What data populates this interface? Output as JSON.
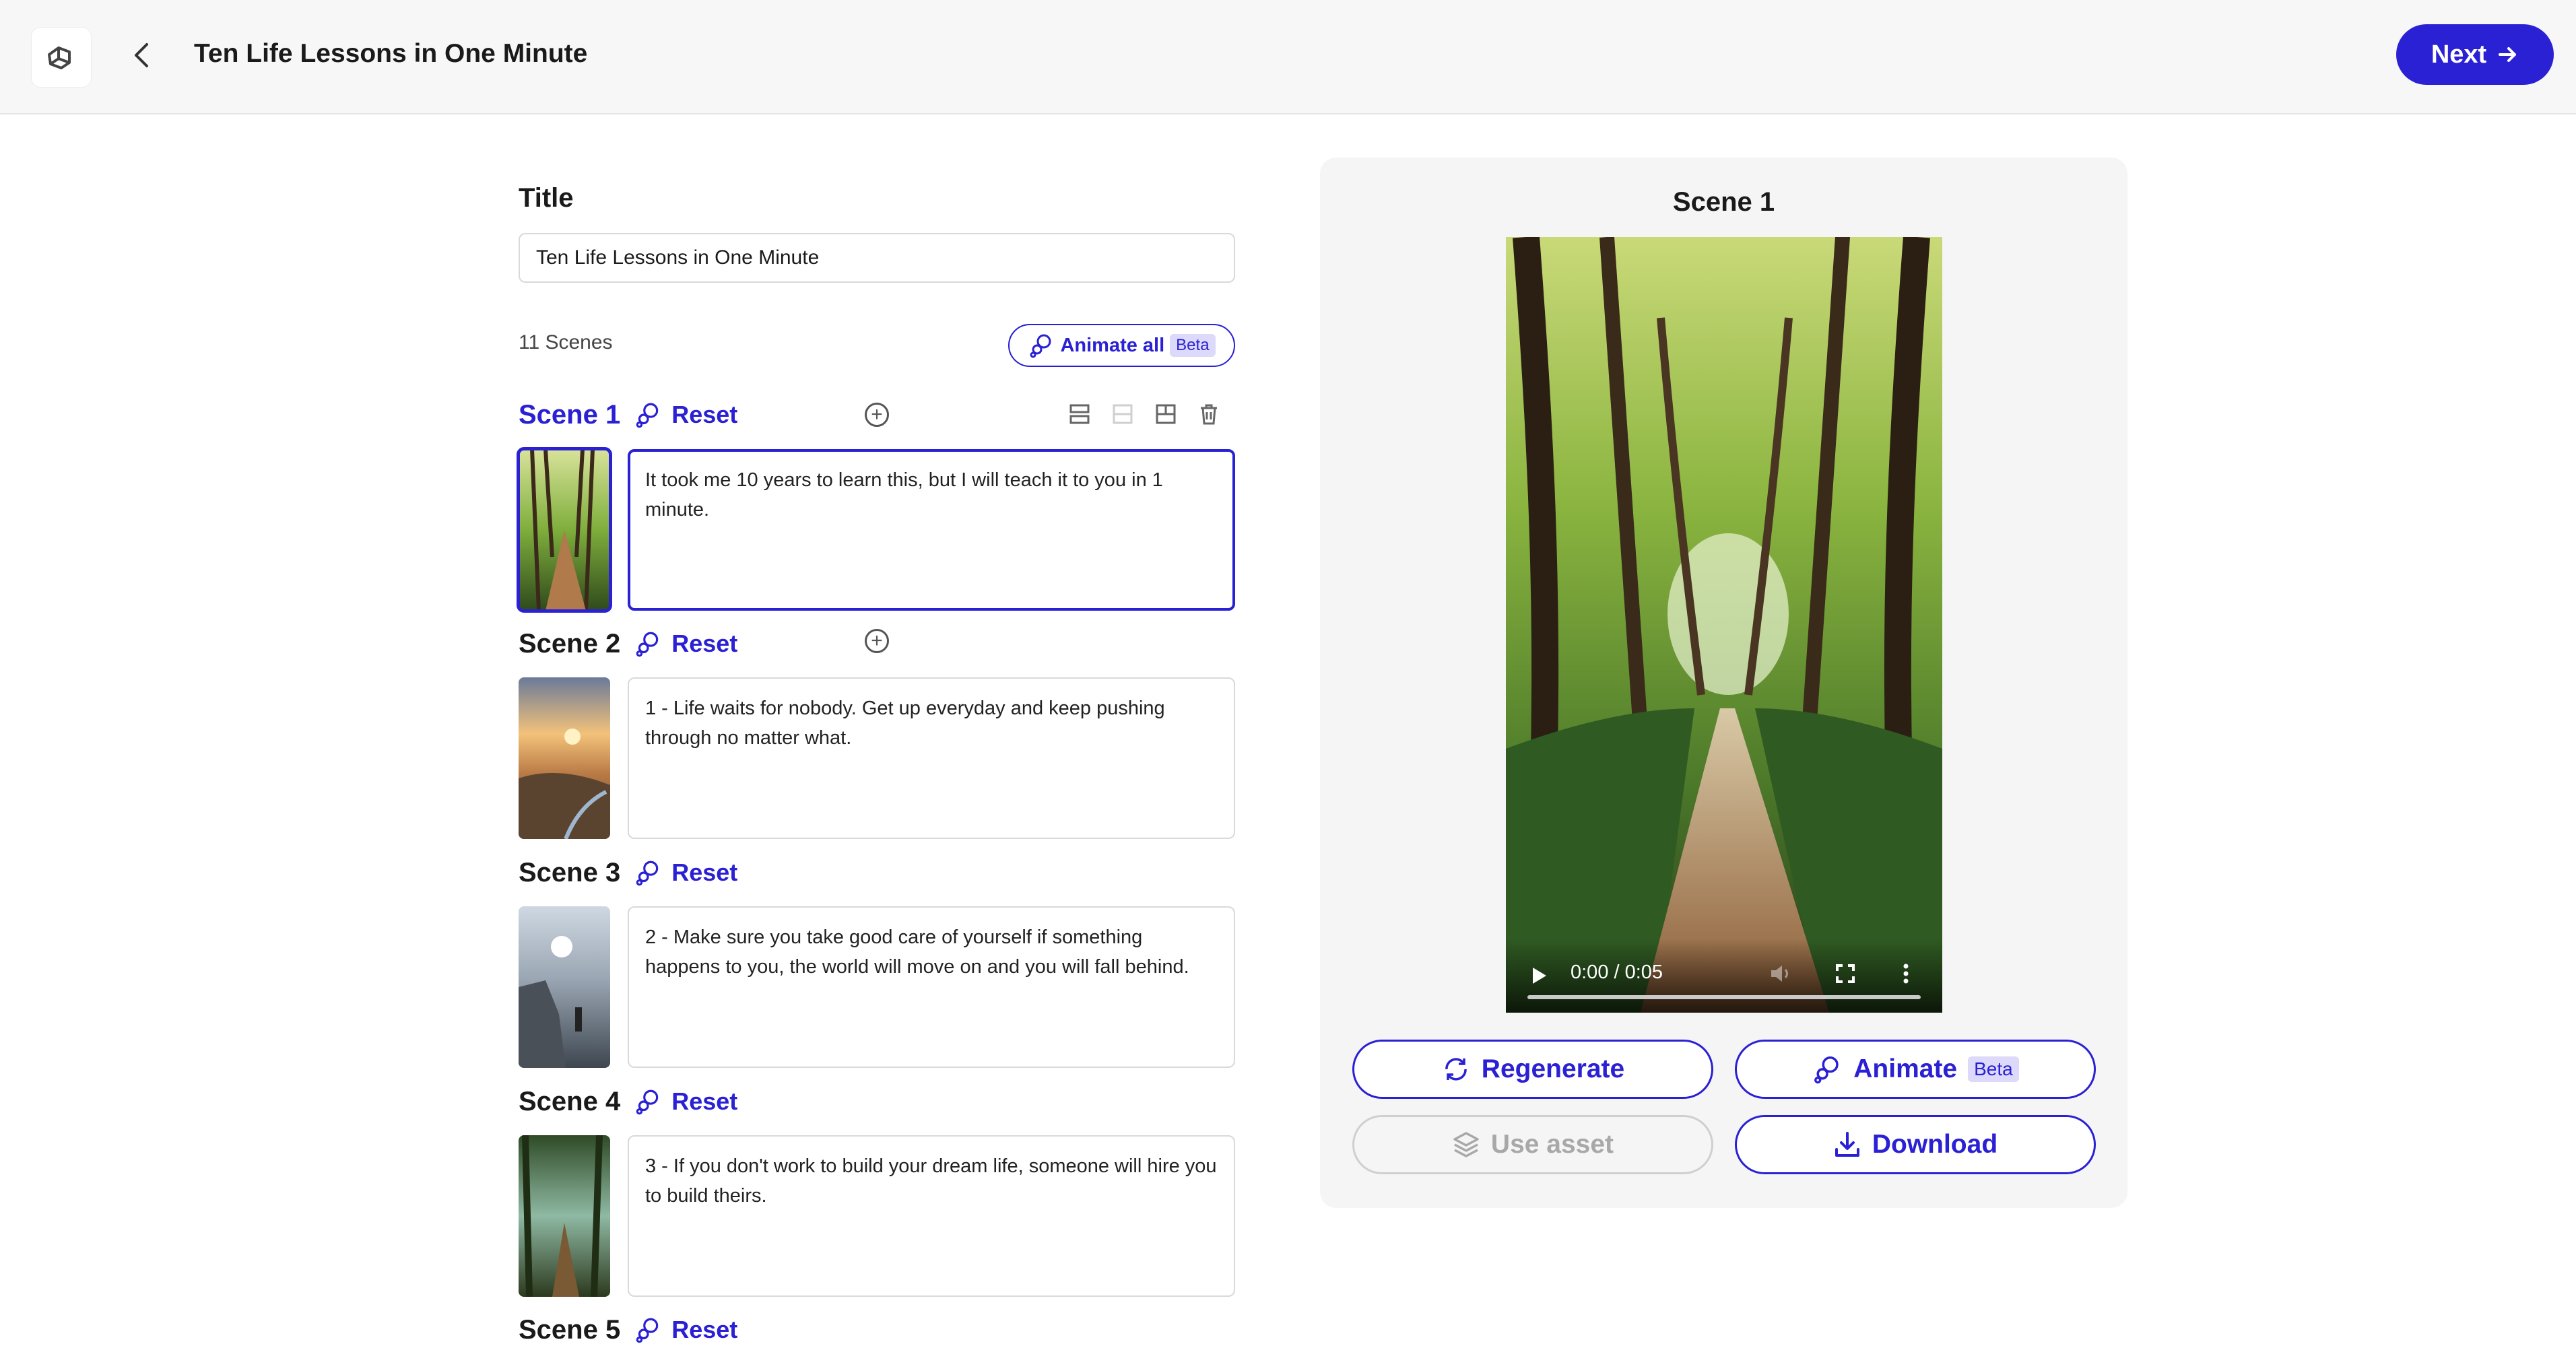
{
  "header": {
    "title": "Ten Life Lessons in One Minute",
    "next_label": "Next",
    "icons": [
      "logo-icon",
      "back-icon",
      "arrow-right-icon"
    ]
  },
  "editor": {
    "title_label": "Title",
    "title_value": "Ten Life Lessons in One Minute",
    "scene_count": "11 Scenes",
    "animate_all_label": "Animate all",
    "beta_label": "Beta",
    "reset_label": "Reset",
    "scenes": [
      {
        "name": "Scene 1",
        "text": "It took me 10 years to learn this, but I will teach it to you in 1 minute.",
        "active": true
      },
      {
        "name": "Scene 2",
        "text": "1 - Life waits for nobody. Get up everyday and keep pushing through no matter what."
      },
      {
        "name": "Scene 3",
        "text": "2 - Make sure you take good care of yourself if something happens to you, the world will move on and you will fall behind."
      },
      {
        "name": "Scene 4",
        "text": "3 - If you don't work to build your dream life, someone will hire you to build theirs."
      },
      {
        "name": "Scene 5",
        "text": ""
      }
    ]
  },
  "preview": {
    "title": "Scene 1",
    "time": "0:00 / 0:05",
    "progress": 0,
    "regenerate_label": "Regenerate",
    "animate_label": "Animate",
    "beta_label": "Beta",
    "use_asset_label": "Use asset",
    "download_label": "Download"
  },
  "colors": {
    "accent": "#2a20d4",
    "badge_bg": "#dcd9fb",
    "panel_bg": "#f5f5f5"
  }
}
